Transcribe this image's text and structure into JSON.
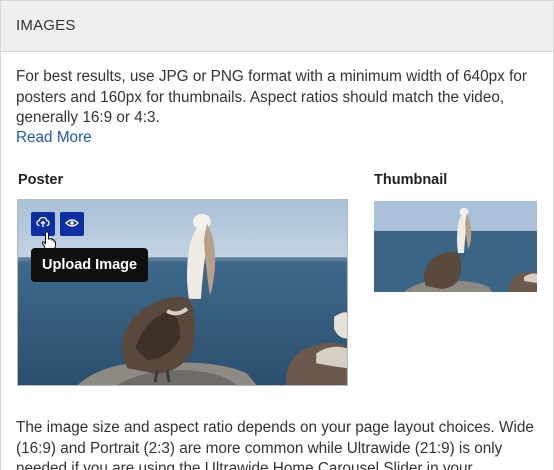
{
  "section": {
    "title": "IMAGES"
  },
  "intro": {
    "text": "For best results, use JPG or PNG format with a minimum width of 640px for posters and 160px for thumbnails. Aspect ratios should match the video, generally 16:9 or 4:3.",
    "read_more": "Read More"
  },
  "poster": {
    "label": "Poster",
    "upload_icon": "upload-icon",
    "preview_icon": "eye-icon",
    "tooltip": "Upload Image"
  },
  "thumbnail": {
    "label": "Thumbnail"
  },
  "footer": {
    "text": "The image size and aspect ratio depends on your page layout choices. Wide (16:9) and Portrait (2:3) are more common while Ultrawide (21:9) is only needed if you are using the Ultrawide Home Carousel Slider in your"
  },
  "colors": {
    "accent": "#0d2ea3",
    "link": "#1a58c9",
    "header_bg": "#efefef",
    "tooltip_bg": "#0f0f0f"
  }
}
